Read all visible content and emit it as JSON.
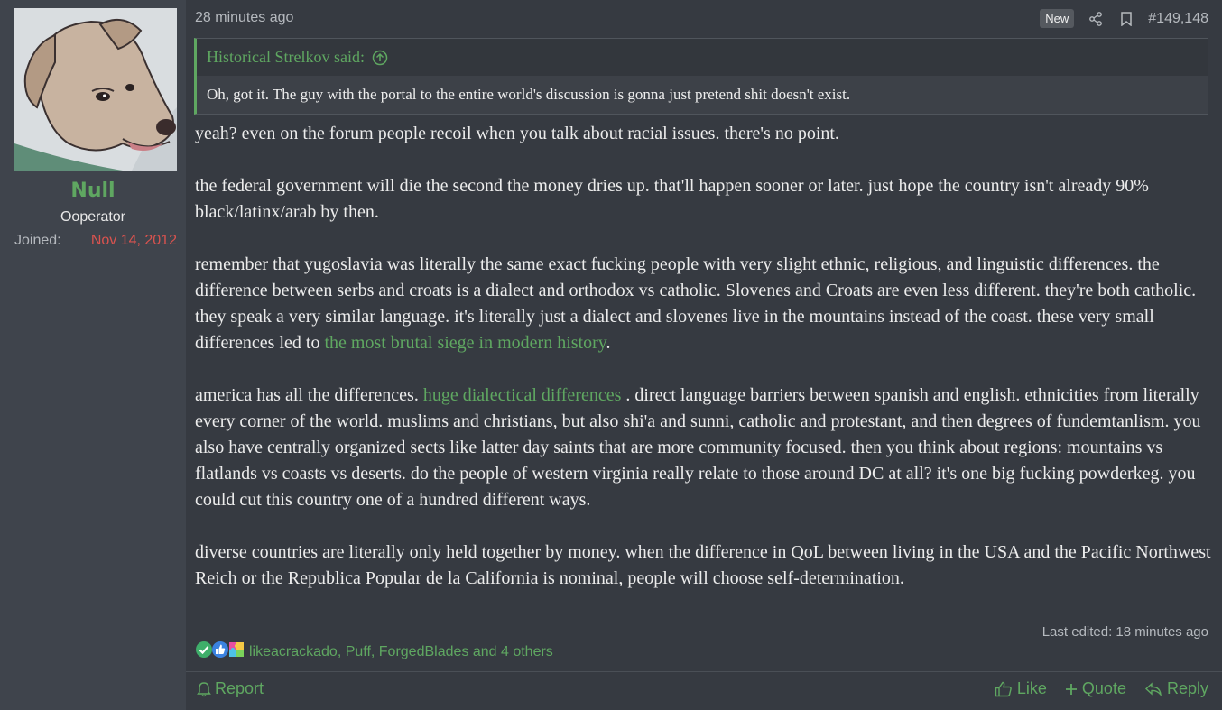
{
  "user": {
    "name": "Null",
    "title": "Ooperator",
    "joined_label": "Joined:",
    "joined_date": "Nov 14, 2012"
  },
  "post": {
    "time": "28 minutes ago",
    "badge": "New",
    "number": "#149,148",
    "quote": {
      "author": "Historical Strelkov said:",
      "text": "Oh, got it. The guy with the portal to the entire world's discussion is gonna just pretend shit doesn't exist."
    },
    "paragraphs": [
      {
        "text": "yeah? even on the forum people recoil when you talk about racial issues. there's no point."
      },
      {
        "text": "the federal government will die the second the money dries up. that'll happen sooner or later. just hope the country isn't already 90% black/latinx/arab by then."
      },
      {
        "before": "remember that yugoslavia was literally the same exact fucking people with very slight ethnic, religious, and linguistic differences. the difference between serbs and croats is a dialect and orthodox vs catholic. Slovenes and Croats are even less different. they're both catholic. they speak a very similar language. it's literally just a dialect and slovenes live in the mountains instead of the coast. these very small differences led to ",
        "link": "the most brutal siege in modern history",
        "after": "."
      },
      {
        "before": "america has all the differences. ",
        "link": "huge dialectical differences",
        "after": " . direct language barriers between spanish and english. ethnicities from literally every corner of the world. muslims and christians, but also shi'a and sunni, catholic and protestant, and then degrees of fundemtanlism. you also have centrally organized sects like latter day saints that are more community focused. then you think about regions: mountains vs flatlands vs coasts vs deserts. do the people of western virginia really relate to those around DC at all? it's one big fucking powderkeg. you could cut this country one of a hundred different ways."
      },
      {
        "text": "diverse countries are literally only held together by money. when the difference in QoL between living in the USA and the Pacific Northwest Reich or the Republica Popular de la California is nominal, people will choose self-determination."
      }
    ],
    "last_edited": "Last edited: 18 minutes ago",
    "reactions": {
      "icons": [
        "check-reaction-icon",
        "thumbs-up-reaction-icon",
        "puzzle-reaction-icon"
      ],
      "names": "likeacrackado, Puff, ForgedBlades and 4 others"
    }
  },
  "footer": {
    "report": "Report",
    "like": "Like",
    "quote": "Quote",
    "reply": "Reply"
  },
  "colors": {
    "accent_green": "#5fa761",
    "date_red": "#d9534f",
    "background": "#363a41",
    "user_panel": "#3f444c"
  }
}
